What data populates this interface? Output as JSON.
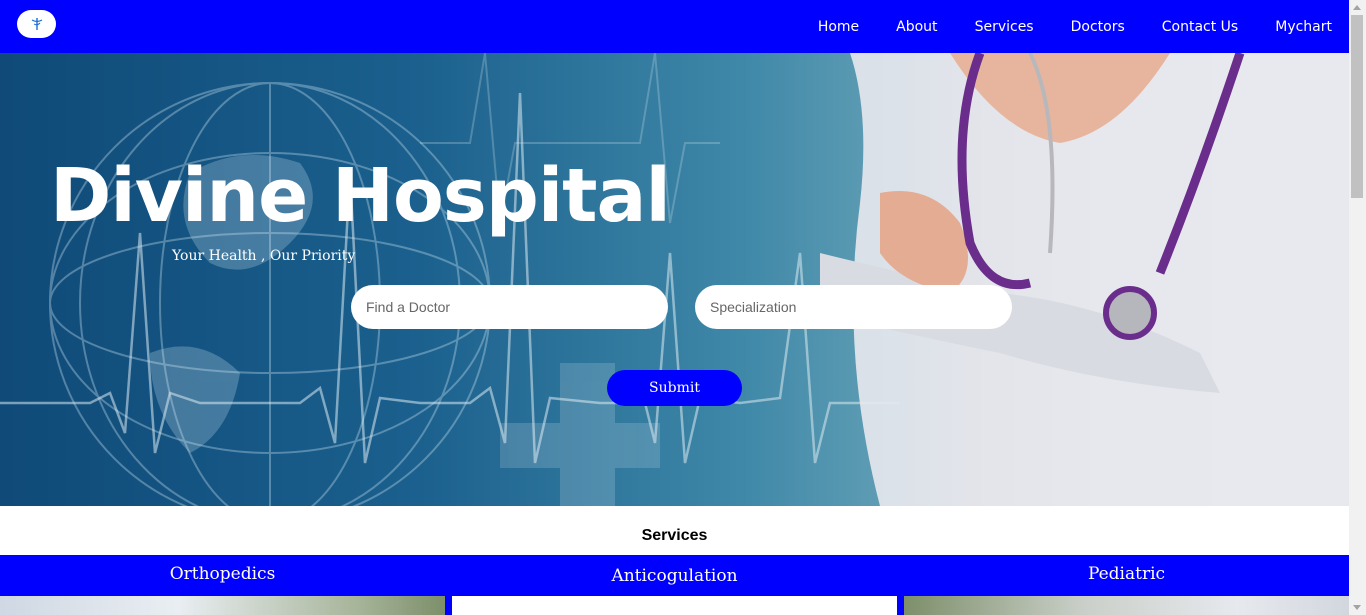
{
  "nav": {
    "logo_icon": "caduceus-icon",
    "links": [
      "Home",
      "About",
      "Services",
      "Doctors",
      "Contact Us",
      "Mychart"
    ]
  },
  "hero": {
    "title": "Divine Hospital",
    "tagline": "Your Health , Our Priority",
    "doctor_placeholder": "Find a Doctor",
    "specialization_placeholder": "Specialization",
    "submit_label": "Submit"
  },
  "services": {
    "heading": "Services",
    "cards": [
      {
        "label": "Orthopedics"
      },
      {
        "label": "Anticogulation"
      },
      {
        "label": "Pediatric"
      }
    ]
  },
  "colors": {
    "brand_blue": "#0000ff",
    "white": "#ffffff"
  }
}
